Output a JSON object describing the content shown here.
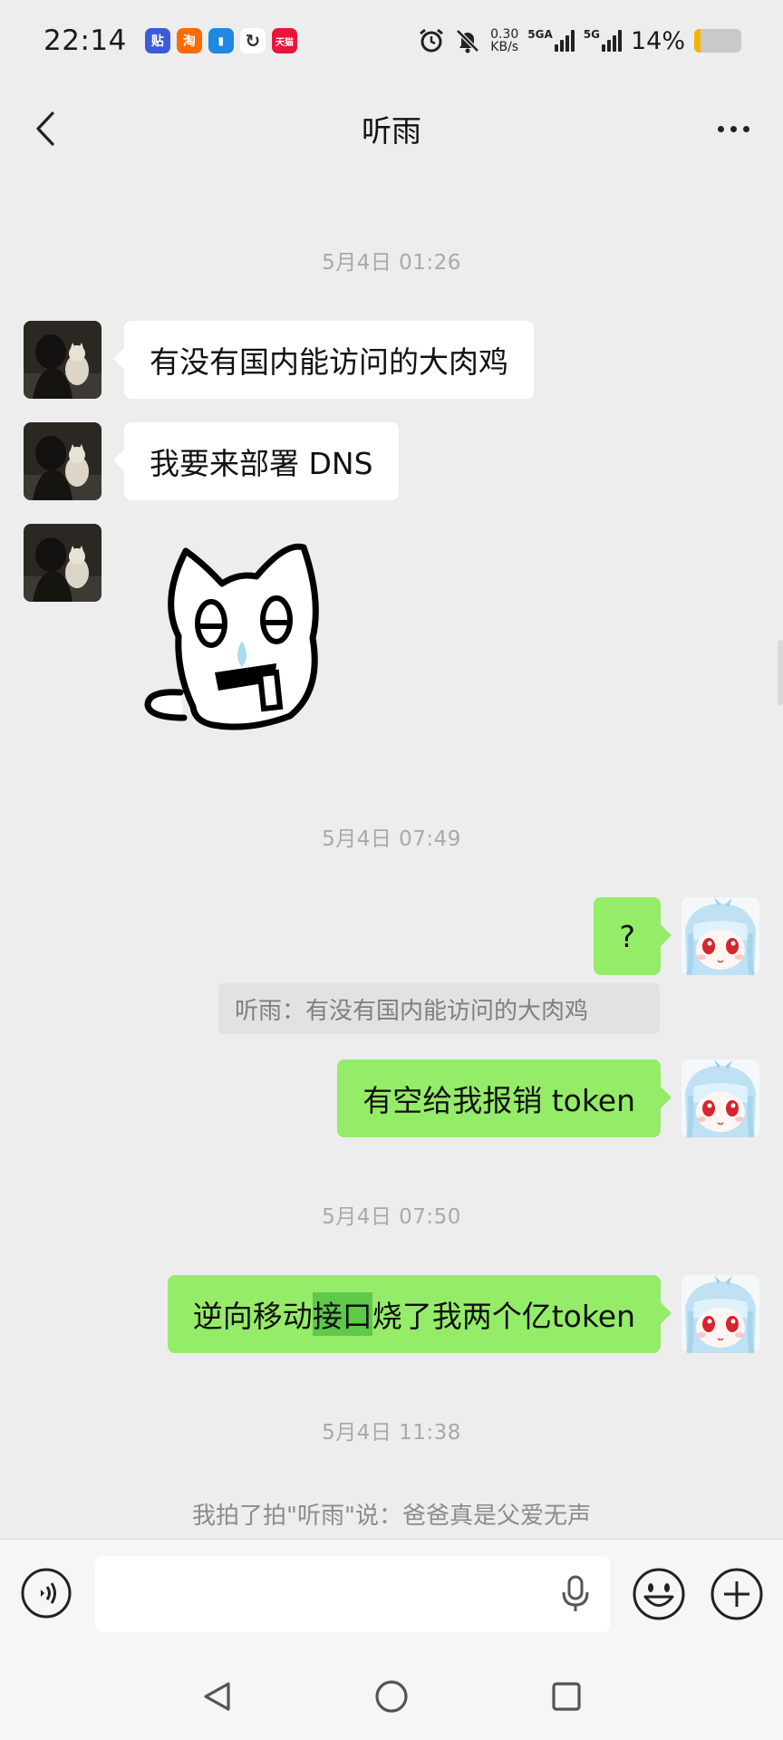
{
  "status_bar": {
    "time": "22:14",
    "app_icons": [
      {
        "name": "tieba-app-icon",
        "glyph": "贴",
        "color": "#3b5bdb"
      },
      {
        "name": "taobao-app-icon",
        "glyph": "淘",
        "color": "#ff6a00"
      },
      {
        "name": "message-app-icon",
        "glyph": "▮",
        "color": "#1e88e5"
      },
      {
        "name": "sync-app-icon",
        "glyph": "↻",
        "color": "#333333"
      },
      {
        "name": "tmall-app-icon",
        "glyph": "天猫",
        "color": "#e8163a"
      }
    ],
    "net_speed_value": "0.30",
    "net_speed_unit": "KB/s",
    "signal1_label": "5GA",
    "signal2_label": "5G",
    "battery_text": "14%",
    "battery_level": 0.14
  },
  "nav": {
    "title": "听雨"
  },
  "messages": {
    "ts1": "5月4日 01:26",
    "m1": "有没有国内能访问的大肉鸡",
    "m2": "我要来部署 DNS",
    "ts2": "5月4日 07:49",
    "m3": "?",
    "quote": "听雨：有没有国内能访问的大肉鸡",
    "m4": "有空给我报销 token",
    "ts3": "5月4日 07:50",
    "m5_pre": "逆向移动",
    "m5_hl": "接口",
    "m5_post": "烧了我两个亿token",
    "ts4": "5月4日 11:38",
    "pat": "我拍了拍\"听雨\"说：爸爸真是父爱无声"
  },
  "colors": {
    "background": "#ededed",
    "bubble_self": "#95ec69",
    "bubble_other": "#ffffff"
  }
}
